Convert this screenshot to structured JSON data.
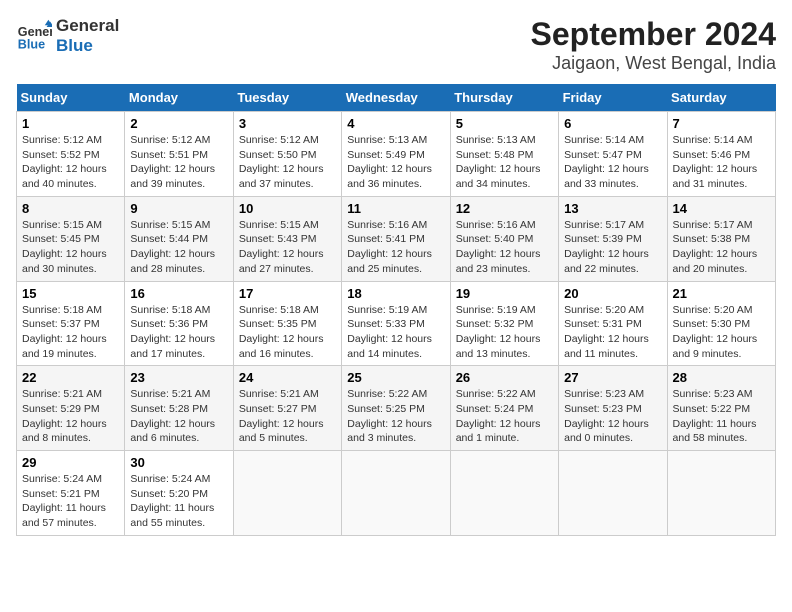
{
  "logo": {
    "line1": "General",
    "line2": "Blue"
  },
  "title": "September 2024",
  "subtitle": "Jaigaon, West Bengal, India",
  "days_header": [
    "Sunday",
    "Monday",
    "Tuesday",
    "Wednesday",
    "Thursday",
    "Friday",
    "Saturday"
  ],
  "weeks": [
    [
      {
        "day": "1",
        "info": "Sunrise: 5:12 AM\nSunset: 5:52 PM\nDaylight: 12 hours\nand 40 minutes."
      },
      {
        "day": "2",
        "info": "Sunrise: 5:12 AM\nSunset: 5:51 PM\nDaylight: 12 hours\nand 39 minutes."
      },
      {
        "day": "3",
        "info": "Sunrise: 5:12 AM\nSunset: 5:50 PM\nDaylight: 12 hours\nand 37 minutes."
      },
      {
        "day": "4",
        "info": "Sunrise: 5:13 AM\nSunset: 5:49 PM\nDaylight: 12 hours\nand 36 minutes."
      },
      {
        "day": "5",
        "info": "Sunrise: 5:13 AM\nSunset: 5:48 PM\nDaylight: 12 hours\nand 34 minutes."
      },
      {
        "day": "6",
        "info": "Sunrise: 5:14 AM\nSunset: 5:47 PM\nDaylight: 12 hours\nand 33 minutes."
      },
      {
        "day": "7",
        "info": "Sunrise: 5:14 AM\nSunset: 5:46 PM\nDaylight: 12 hours\nand 31 minutes."
      }
    ],
    [
      {
        "day": "8",
        "info": "Sunrise: 5:15 AM\nSunset: 5:45 PM\nDaylight: 12 hours\nand 30 minutes."
      },
      {
        "day": "9",
        "info": "Sunrise: 5:15 AM\nSunset: 5:44 PM\nDaylight: 12 hours\nand 28 minutes."
      },
      {
        "day": "10",
        "info": "Sunrise: 5:15 AM\nSunset: 5:43 PM\nDaylight: 12 hours\nand 27 minutes."
      },
      {
        "day": "11",
        "info": "Sunrise: 5:16 AM\nSunset: 5:41 PM\nDaylight: 12 hours\nand 25 minutes."
      },
      {
        "day": "12",
        "info": "Sunrise: 5:16 AM\nSunset: 5:40 PM\nDaylight: 12 hours\nand 23 minutes."
      },
      {
        "day": "13",
        "info": "Sunrise: 5:17 AM\nSunset: 5:39 PM\nDaylight: 12 hours\nand 22 minutes."
      },
      {
        "day": "14",
        "info": "Sunrise: 5:17 AM\nSunset: 5:38 PM\nDaylight: 12 hours\nand 20 minutes."
      }
    ],
    [
      {
        "day": "15",
        "info": "Sunrise: 5:18 AM\nSunset: 5:37 PM\nDaylight: 12 hours\nand 19 minutes."
      },
      {
        "day": "16",
        "info": "Sunrise: 5:18 AM\nSunset: 5:36 PM\nDaylight: 12 hours\nand 17 minutes."
      },
      {
        "day": "17",
        "info": "Sunrise: 5:18 AM\nSunset: 5:35 PM\nDaylight: 12 hours\nand 16 minutes."
      },
      {
        "day": "18",
        "info": "Sunrise: 5:19 AM\nSunset: 5:33 PM\nDaylight: 12 hours\nand 14 minutes."
      },
      {
        "day": "19",
        "info": "Sunrise: 5:19 AM\nSunset: 5:32 PM\nDaylight: 12 hours\nand 13 minutes."
      },
      {
        "day": "20",
        "info": "Sunrise: 5:20 AM\nSunset: 5:31 PM\nDaylight: 12 hours\nand 11 minutes."
      },
      {
        "day": "21",
        "info": "Sunrise: 5:20 AM\nSunset: 5:30 PM\nDaylight: 12 hours\nand 9 minutes."
      }
    ],
    [
      {
        "day": "22",
        "info": "Sunrise: 5:21 AM\nSunset: 5:29 PM\nDaylight: 12 hours\nand 8 minutes."
      },
      {
        "day": "23",
        "info": "Sunrise: 5:21 AM\nSunset: 5:28 PM\nDaylight: 12 hours\nand 6 minutes."
      },
      {
        "day": "24",
        "info": "Sunrise: 5:21 AM\nSunset: 5:27 PM\nDaylight: 12 hours\nand 5 minutes."
      },
      {
        "day": "25",
        "info": "Sunrise: 5:22 AM\nSunset: 5:25 PM\nDaylight: 12 hours\nand 3 minutes."
      },
      {
        "day": "26",
        "info": "Sunrise: 5:22 AM\nSunset: 5:24 PM\nDaylight: 12 hours\nand 1 minute."
      },
      {
        "day": "27",
        "info": "Sunrise: 5:23 AM\nSunset: 5:23 PM\nDaylight: 12 hours\nand 0 minutes."
      },
      {
        "day": "28",
        "info": "Sunrise: 5:23 AM\nSunset: 5:22 PM\nDaylight: 11 hours\nand 58 minutes."
      }
    ],
    [
      {
        "day": "29",
        "info": "Sunrise: 5:24 AM\nSunset: 5:21 PM\nDaylight: 11 hours\nand 57 minutes."
      },
      {
        "day": "30",
        "info": "Sunrise: 5:24 AM\nSunset: 5:20 PM\nDaylight: 11 hours\nand 55 minutes."
      },
      {
        "day": "",
        "info": ""
      },
      {
        "day": "",
        "info": ""
      },
      {
        "day": "",
        "info": ""
      },
      {
        "day": "",
        "info": ""
      },
      {
        "day": "",
        "info": ""
      }
    ]
  ]
}
